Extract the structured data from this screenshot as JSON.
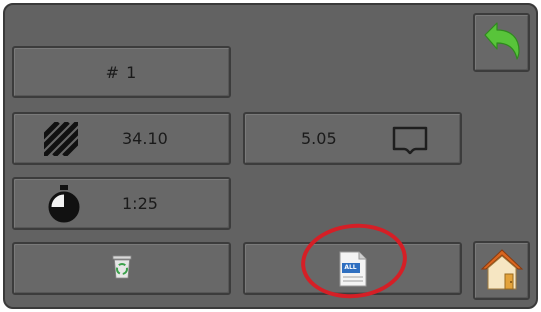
{
  "record": {
    "number_label": "# 1",
    "area_value": "34.10",
    "distance_value": "5.05",
    "time_value": "1:25"
  },
  "icons": {
    "area": "hatched-area-icon",
    "distance": "distance-flag-icon",
    "time": "stopwatch-icon",
    "delete": "recycle-bin-icon",
    "report": "report-document-icon",
    "report_tag": "ALL",
    "back": "back-arrow-icon",
    "home": "home-icon"
  },
  "colors": {
    "panel": "#626262",
    "button": "#686868",
    "back_arrow": "#58c43a",
    "highlight": "#d51f26",
    "home_roof": "#d9661f"
  }
}
